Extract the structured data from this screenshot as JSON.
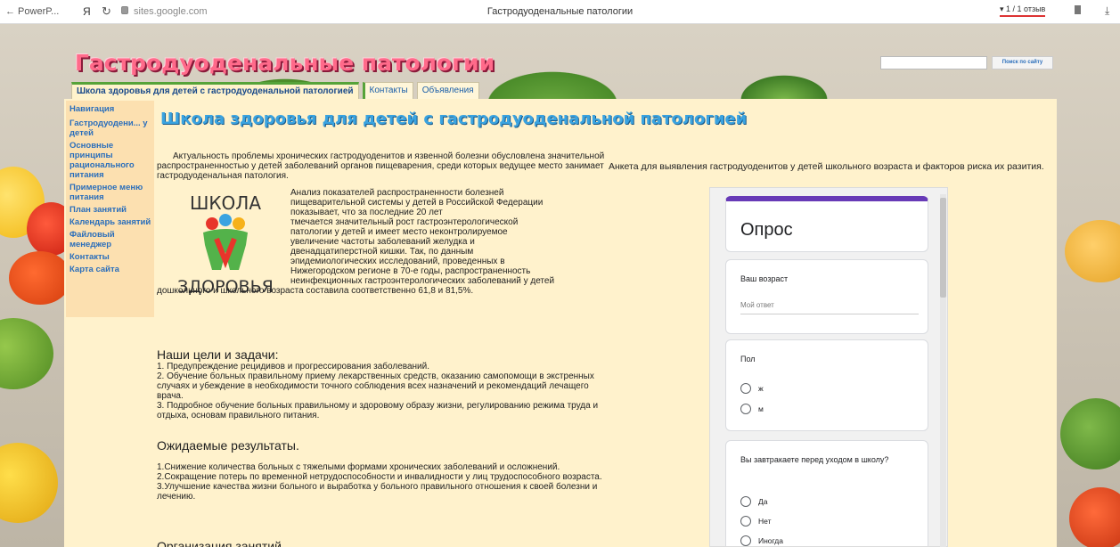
{
  "browser": {
    "back_label": "← PowerP...",
    "yandex": "Я",
    "reload": "↻",
    "url": "sites.google.com",
    "tab_title": "Гастродуоденальные патологии",
    "reviews": "▾ 1 / 1 отзыв",
    "download": "⤓"
  },
  "site": {
    "title": "Гастродуоденальные патологии",
    "search_button": "Поиск по сайту",
    "search_value": ""
  },
  "tabs": [
    {
      "label": "Школа здоровья для детей с гастродуоденальной патологией"
    },
    {
      "label": "Контакты"
    },
    {
      "label": "Объявления"
    }
  ],
  "sidebar": {
    "items": [
      {
        "label": "Навигация"
      },
      {
        "label": "Гастродуодени... у детей"
      },
      {
        "label": "Основные принципы рационального питания"
      },
      {
        "label": "Примерное меню питания"
      },
      {
        "label": "План занятий"
      },
      {
        "label": "Календарь занятий"
      },
      {
        "label": "Файловый менеджер"
      },
      {
        "label": "Контакты"
      },
      {
        "label": "Карта сайта"
      }
    ]
  },
  "main": {
    "heading": "Школа здоровья для детей с гастродуоденальной патологией",
    "intro": "Актуальность проблемы хронических гастродуоденитов и язвенной болезни обусловлена значительной распространенностью у детей заболеваний органов пищеварения, среди которых ведущее место занимает гастродуоденальная патология.",
    "analysis_lines": [
      "Анализ показателей распространенности болезней",
      "пищеварительной системы у детей в Российской Федерации",
      "показывает, что за последние 20 лет",
      "тмечается значительный рост гастроэнтерологической",
      "патологии у детей и имеет место неконтролируемое",
      "увеличение частоты заболеваний желудка и",
      "двенадцатиперстной кишки. Так, по данным",
      "эпидемиологических исследований, проведенных в",
      "Нижегородском регионе в 70-е годы, распространенность",
      "неинфекционных гастроэнтерологических заболеваний у детей"
    ],
    "analysis_tail": "дошкольного и школьного возраста составила соответственно 61,8 и 81,5%.",
    "logo_top": "ШКОЛА",
    "logo_bottom": "ЗДОРОВЬЯ",
    "goals_heading": "Наши цели и задачи:",
    "goals": [
      "1. Предупреждение рецидивов и прогрессирования заболеваний.",
      "2. Обучение больных правильному приему лекарственных средств, оказанию самопомощи в экстренных случаях и убеждение в необходимости точного соблюдения всех назначений и рекомендаций лечащего врача.",
      "3. Подробное обучение больных правильному и здоровому образу жизни, регулированию режима труда и отдыха, основам правильного питания."
    ],
    "results_heading": "Ожидаемые результаты.",
    "results": [
      "1.Снижение количества больных с тяжелыми формами хронических заболеваний и осложнений.",
      "2.Сокращение потерь по временной нетрудоспособности и инвалидности у лиц трудоспособного возраста.",
      "3.Улучшение качества жизни больного и выработка у больного правильного отношения к своей болезни и лечению."
    ],
    "next_heading": "Организация занятий"
  },
  "survey": {
    "caption": "Анкета для выявления гастродуоденитов у детей школьного возраста и факторов риска их разития.",
    "form_title": "Опрос",
    "q1": {
      "label": "Ваш возраст",
      "placeholder": "Мой ответ"
    },
    "q2": {
      "label": "Пол",
      "options": [
        "ж",
        "м"
      ]
    },
    "q3": {
      "label": "Вы завтракаете перед уходом в школу?",
      "options": [
        "Да",
        "Нет",
        "Иногда"
      ]
    }
  },
  "colors": {
    "page_bg": "#fff2cc",
    "sidebar_bg": "#fce0b0",
    "heading": "#3aa3e0",
    "link": "#2a6ebb",
    "title_pink": "#ff6a8a",
    "form_accent": "#673ab7"
  }
}
